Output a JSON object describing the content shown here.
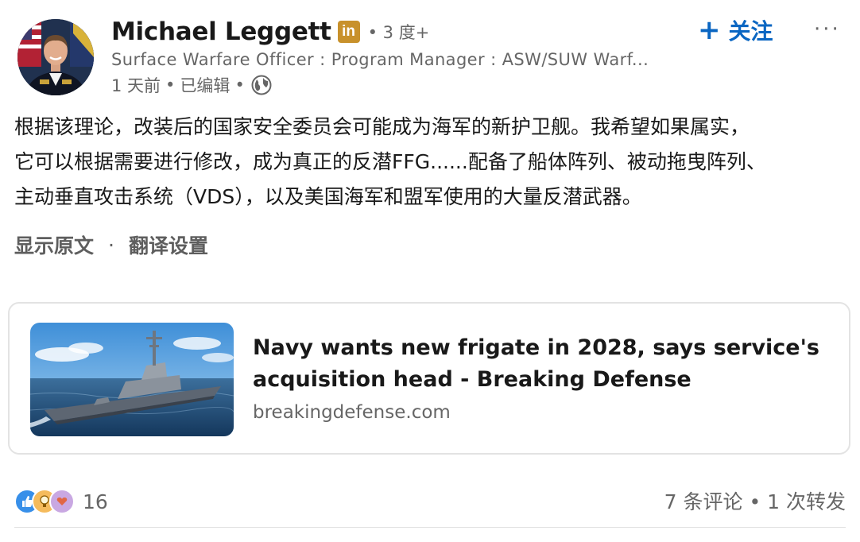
{
  "author": {
    "name": "Michael Leggett",
    "badge": "in",
    "degree": "• 3 度+",
    "headline": "Surface Warfare Officer : Program Manager : ASW/SUW Warf...",
    "time": "1 天前",
    "edited": "已编辑",
    "sep": "•"
  },
  "actions": {
    "follow_plus": "+",
    "follow": "关注",
    "more": "···"
  },
  "post": {
    "lines": [
      "根据该理论，改装后的国家安全委员会可能成为海军的新护卫舰。我希望如果属实，",
      "它可以根据需要进行修改，成为真正的反潜FFG......配备了船体阵列、被动拖曳阵列、",
      "主动垂直攻击系统（VDS），以及美国海军和盟军使用的大量反潜武器。"
    ],
    "show_original": "显示原文",
    "dot": "·",
    "translate_settings": "翻译设置"
  },
  "link_card": {
    "title": "Navy wants new frigate in 2028, says service's acquisition head - Breaking Defense",
    "source": "breakingdefense.com",
    "thumbnail_icon": "frigate-ship-image"
  },
  "footer": {
    "reaction_count": "16",
    "social_counts": "7 条评论 • 1 次转发",
    "reaction_icons": [
      "like-icon",
      "insightful-icon",
      "support-icon"
    ]
  },
  "colors": {
    "accent": "#0a66c2",
    "linkedin_badge": "#c8912b",
    "muted": "#666666"
  }
}
